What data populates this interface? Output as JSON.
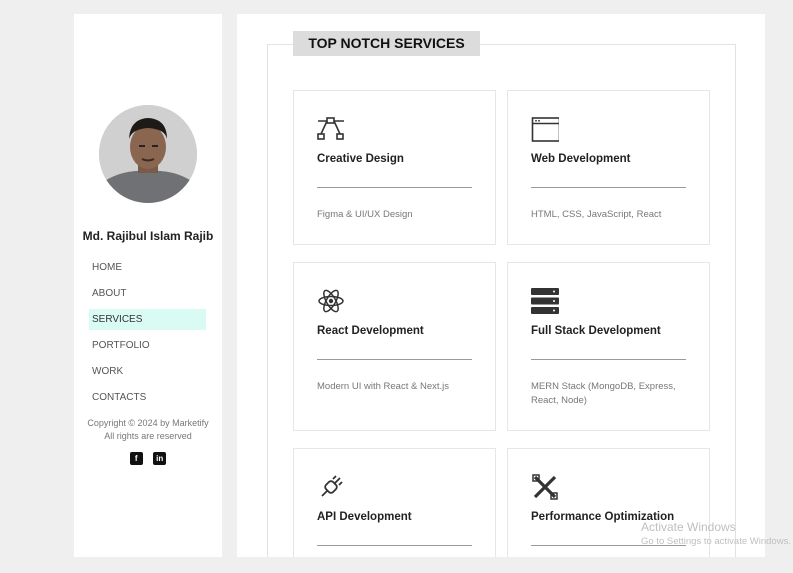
{
  "sidebar": {
    "name": "Md. Rajibul Islam Rajib",
    "nav": [
      {
        "label": "HOME"
      },
      {
        "label": "ABOUT"
      },
      {
        "label": "SERVICES",
        "active": true
      },
      {
        "label": "PORTFOLIO"
      },
      {
        "label": "WORK"
      },
      {
        "label": "CONTACTS"
      }
    ],
    "copyright_line1": "Copyright © 2024 by Marketify",
    "copyright_line2": "All rights are reserved",
    "socials": [
      {
        "icon": "facebook-icon",
        "glyph": "f"
      },
      {
        "icon": "linkedin-icon",
        "glyph": "in"
      }
    ]
  },
  "main": {
    "section_title": "TOP NOTCH SERVICES",
    "services": [
      {
        "title": "Creative Design",
        "desc": "Figma & UI/UX Design",
        "icon": "vector-pen-icon"
      },
      {
        "title": "Web Development",
        "desc": "HTML, CSS, JavaScript, React",
        "icon": "browser-window-icon"
      },
      {
        "title": "React Development",
        "desc": "Modern UI with React & Next.js",
        "icon": "react-atom-icon"
      },
      {
        "title": "Full Stack Development",
        "desc": "MERN Stack (MongoDB, Express, React, Node)",
        "icon": "server-stack-icon"
      },
      {
        "title": "API Development",
        "desc": "",
        "icon": "plug-icon"
      },
      {
        "title": "Performance Optimization",
        "desc": "",
        "icon": "tools-icon"
      }
    ]
  },
  "watermark": {
    "line1": "Activate Windows",
    "line2": "Go to Settings to activate Windows."
  },
  "colors": {
    "active_nav_bg": "#d9fbf3",
    "title_bg": "#dcdcdc",
    "page_bg": "#efefef"
  }
}
